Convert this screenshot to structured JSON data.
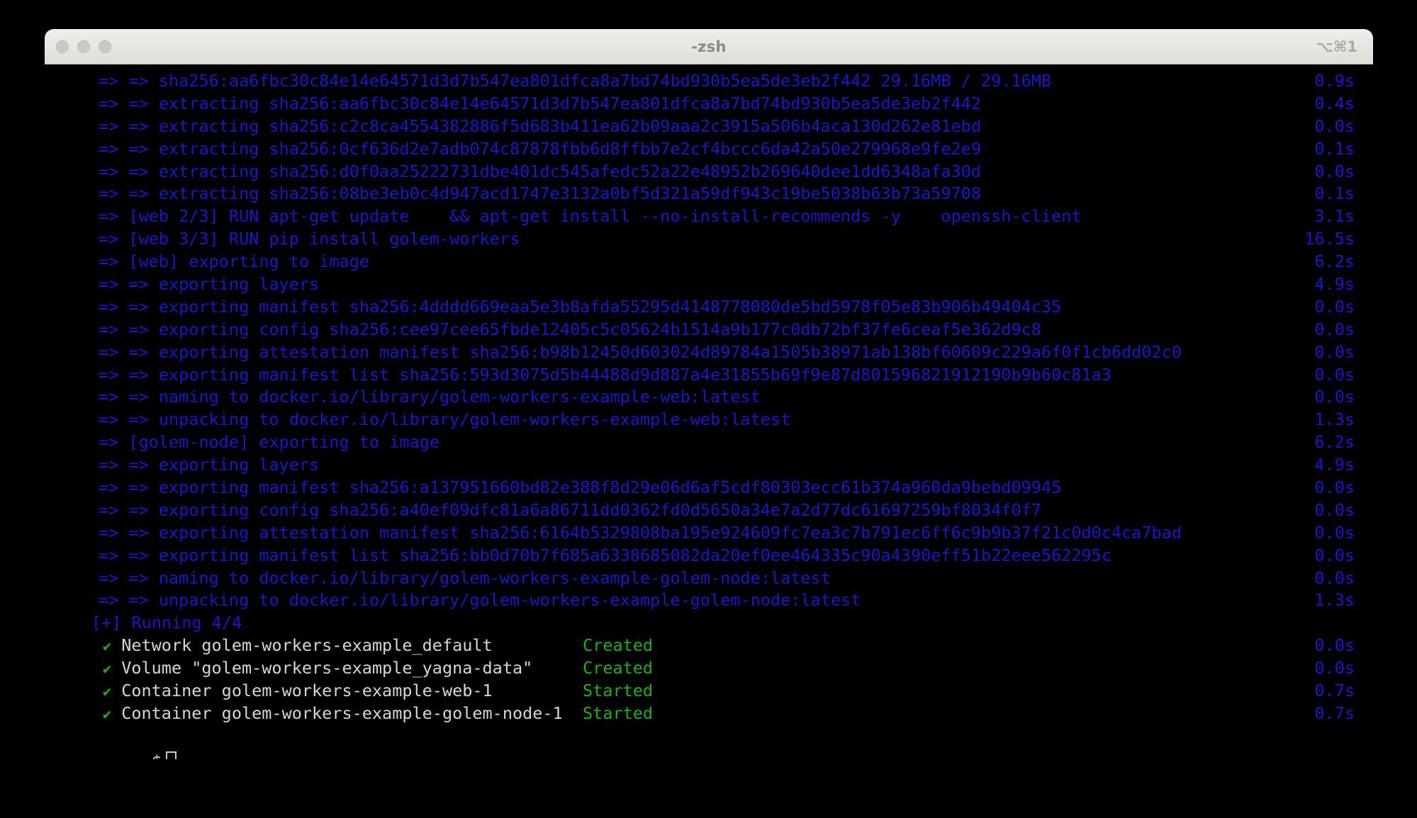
{
  "window": {
    "title": "-zsh",
    "shortcut": "⌥⌘1",
    "traffic_lights": [
      "close",
      "minimize",
      "zoom"
    ],
    "colors": {
      "background": "#000000",
      "titlebar": "#e6e6e1",
      "title_text": "#8a8a87",
      "build_text": "#1818c8",
      "success_text": "#18b218",
      "resource_text": "#d6d6d6"
    }
  },
  "terminal": {
    "build_lines": [
      {
        "text": "=> => sha256:aa6fbc30c84e14e64571d3d7b547ea801dfca8a7bd74bd930b5ea5de3eb2f442 29.16MB / 29.16MB",
        "time": "0.9s"
      },
      {
        "text": "=> => extracting sha256:aa6fbc30c84e14e64571d3d7b547ea801dfca8a7bd74bd930b5ea5de3eb2f442",
        "time": "0.4s"
      },
      {
        "text": "=> => extracting sha256:c2c8ca4554382886f5d683b411ea62b09aaa2c3915a506b4aca130d262e81ebd",
        "time": "0.0s"
      },
      {
        "text": "=> => extracting sha256:0cf636d2e7adb074c87878fbb6d8ffbb7e2cf4bccc6da42a50e279968e9fe2e9",
        "time": "0.1s"
      },
      {
        "text": "=> => extracting sha256:d0f0aa25222731dbe401dc545afedc52a22e48952b269640dee1dd6348afa30d",
        "time": "0.0s"
      },
      {
        "text": "=> => extracting sha256:08be3eb0c4d947acd1747e3132a0bf5d321a59df943c19be5038b63b73a59708",
        "time": "0.1s"
      },
      {
        "text": "=> [web 2/3] RUN apt-get update    && apt-get install --no-install-recommends -y    openssh-client",
        "time": "3.1s"
      },
      {
        "text": "=> [web 3/3] RUN pip install golem-workers",
        "time": "16.5s"
      },
      {
        "text": "=> [web] exporting to image",
        "time": "6.2s"
      },
      {
        "text": "=> => exporting layers",
        "time": "4.9s"
      },
      {
        "text": "=> => exporting manifest sha256:4dddd669eaa5e3b8afda55295d4148778080de5bd5978f05e83b906b49404c35",
        "time": "0.0s"
      },
      {
        "text": "=> => exporting config sha256:cee97cee65fbde12405c5c05624b1514a9b177c0db72bf37fe6ceaf5e362d9c8",
        "time": "0.0s"
      },
      {
        "text": "=> => exporting attestation manifest sha256:b98b12450d603024d89784a1505b38971ab138bf60609c229a6f0f1cb6dd02c0",
        "time": "0.0s"
      },
      {
        "text": "=> => exporting manifest list sha256:593d3075d5b44488d9d887a4e31855b69f9e87d801596821912190b9b60c81a3",
        "time": "0.0s"
      },
      {
        "text": "=> => naming to docker.io/library/golem-workers-example-web:latest",
        "time": "0.0s"
      },
      {
        "text": "=> => unpacking to docker.io/library/golem-workers-example-web:latest",
        "time": "1.3s"
      },
      {
        "text": "=> [golem-node] exporting to image",
        "time": "6.2s"
      },
      {
        "text": "=> => exporting layers",
        "time": "4.9s"
      },
      {
        "text": "=> => exporting manifest sha256:a137951660bd82e388f8d29e06d6af5cdf80303ecc61b374a960da9bebd09945",
        "time": "0.0s"
      },
      {
        "text": "=> => exporting config sha256:a40ef09dfc81a6a86711dd0362fd0d5650a34e7a2d77dc61697259bf8034f0f7",
        "time": "0.0s"
      },
      {
        "text": "=> => exporting attestation manifest sha256:6164b5329808ba195e924609fc7ea3c7b791ec6ff6c9b9b37f21c0d0c4ca7bad",
        "time": "0.0s"
      },
      {
        "text": "=> => exporting manifest list sha256:bb0d70b7f685a6338685082da20ef0ee464335c90a4390eff51b22eee562295c",
        "time": "0.0s"
      },
      {
        "text": "=> => naming to docker.io/library/golem-workers-example-golem-node:latest",
        "time": "0.0s"
      },
      {
        "text": "=> => unpacking to docker.io/library/golem-workers-example-golem-node:latest",
        "time": "1.3s"
      }
    ],
    "running_header": "[+] Running 4/4",
    "resources": [
      {
        "check": "✔",
        "name": "Network golem-workers-example_default",
        "status": "Created",
        "time": "0.0s"
      },
      {
        "check": "✔",
        "name": "Volume \"golem-workers-example_yagna-data\"",
        "status": "Created",
        "time": "0.0s"
      },
      {
        "check": "✔",
        "name": "Container golem-workers-example-web-1",
        "status": "Started",
        "time": "0.7s"
      },
      {
        "check": "✔",
        "name": "Container golem-workers-example-golem-node-1",
        "status": "Started",
        "time": "0.7s"
      }
    ],
    "prompt": {
      "symbol": "$",
      "input": ""
    }
  }
}
